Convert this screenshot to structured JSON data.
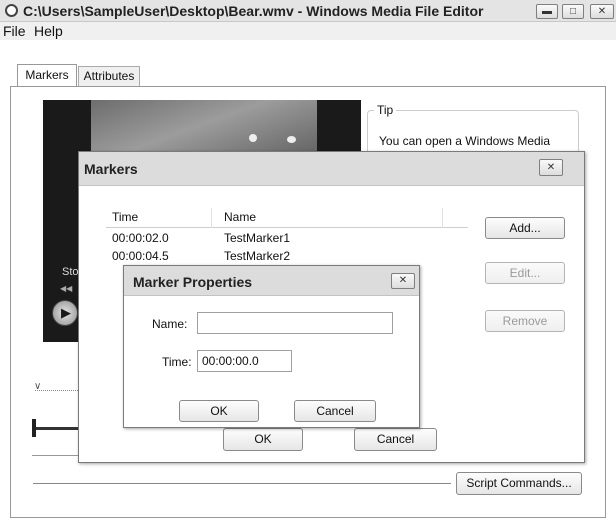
{
  "window": {
    "title": "C:\\Users\\SampleUser\\Desktop\\Bear.wmv - Windows Media File Editor",
    "menu": [
      "File",
      "Help"
    ],
    "tabs": [
      "Markers",
      "Attributes"
    ]
  },
  "player": {
    "status_text": "Sto"
  },
  "tip": {
    "label": "Tip",
    "text": "You can open a Windows Media"
  },
  "script_commands_button": "Script Commands...",
  "markers_dialog": {
    "title": "Markers",
    "columns": [
      "Time",
      "Name"
    ],
    "rows": [
      {
        "time": "00:00:02.0",
        "name": "TestMarker1"
      },
      {
        "time": "00:00:04.5",
        "name": "TestMarker2"
      }
    ],
    "buttons": {
      "add": "Add...",
      "edit": "Edit...",
      "remove": "Remove"
    },
    "ok": "OK",
    "cancel": "Cancel"
  },
  "marker_properties": {
    "title": "Marker Properties",
    "name_label": "Name:",
    "name_value": "",
    "time_label": "Time:",
    "time_value": "00:00:00.0",
    "ok": "OK",
    "cancel": "Cancel"
  }
}
